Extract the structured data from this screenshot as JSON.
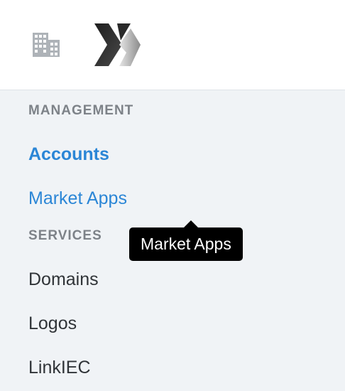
{
  "header": {
    "org_icon": "building-icon",
    "logo_icon": "x-logo-icon"
  },
  "sidebar": {
    "sections": [
      {
        "label": "MANAGEMENT",
        "items": [
          {
            "label": "Accounts",
            "active": true
          },
          {
            "label": "Market Apps",
            "active": false
          }
        ]
      },
      {
        "label": "SERVICES",
        "items": [
          {
            "label": "Domains"
          },
          {
            "label": "Logos"
          },
          {
            "label": "LinkIEC"
          }
        ]
      }
    ]
  },
  "tooltip": {
    "text": "Market Apps"
  },
  "colors": {
    "accent": "#2b86d6",
    "section_label": "#7d8288",
    "text": "#303438",
    "sidebar_bg": "#f0f3f6",
    "tooltip_bg": "#000000"
  }
}
